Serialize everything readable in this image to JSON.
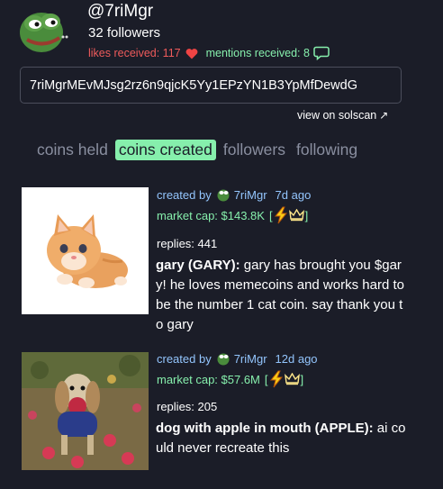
{
  "profile": {
    "username": "@7riMgr",
    "followers": "32 followers",
    "likes_received": "likes received: 117",
    "mentions_received": "mentions received: 8",
    "address": "7riMgrMEvMJsg2rz6n9qjcK5Yy1EPzYN1B3YpMfDewdG",
    "solscan_label": "view on solscan",
    "solscan_arrow": "↗"
  },
  "tabs": [
    {
      "label": "coins held",
      "active": false
    },
    {
      "label": "coins created",
      "active": true
    },
    {
      "label": "followers",
      "active": false
    },
    {
      "label": "following",
      "active": false
    }
  ],
  "coins": [
    {
      "created_by_label": "created by",
      "creator": "7riMgr",
      "age": "7d ago",
      "market_cap_label": "market cap: $143.8K",
      "bracket_open": "[",
      "bracket_close": "]",
      "replies": "replies: 441",
      "name": "gary (GARY):",
      "description": " gary has brought you $gary! he loves memecoins and works hard to be the number 1 cat coin. say thank you to gary"
    },
    {
      "created_by_label": "created by",
      "creator": "7riMgr",
      "age": "12d ago",
      "market_cap_label": "market cap: $57.6M",
      "bracket_open": "[",
      "bracket_close": "]",
      "replies": "replies: 205",
      "name": "dog with apple in mouth (APPLE):",
      "description": " ai could never recreate this"
    }
  ],
  "colors": {
    "background": "#1b1d28",
    "accent_green": "#86efac",
    "link_blue": "#93c5fd",
    "likes_red": "#ef5b5b",
    "tab_inactive": "#8a8fa0"
  },
  "icons": [
    "pepe-avatar-icon",
    "heart-icon",
    "chat-bubble-icon",
    "external-link-icon",
    "lightning-icon",
    "crown-icon"
  ]
}
